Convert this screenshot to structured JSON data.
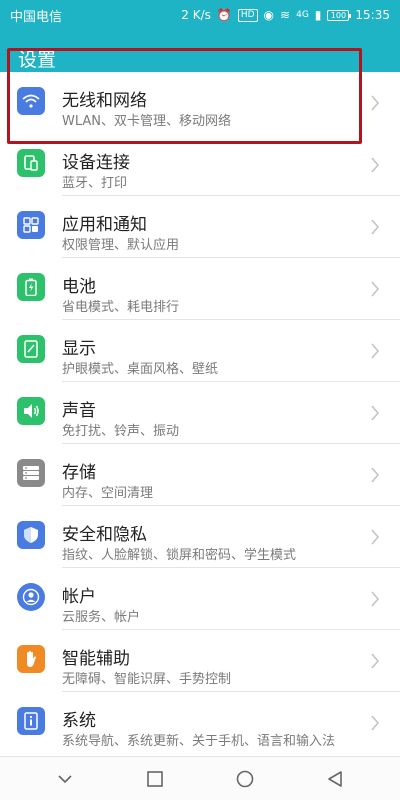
{
  "status_bar": {
    "carrier": "中国电信",
    "speed": "2 K/s",
    "hd": "HD",
    "network": "4G",
    "battery": "100",
    "time": "15:35"
  },
  "header": {
    "title": "设置"
  },
  "items": [
    {
      "title": "无线和网络",
      "subtitle": "WLAN、双卡管理、移动网络",
      "icon": "wifi-icon",
      "color": "#4a7be0"
    },
    {
      "title": "设备连接",
      "subtitle": "蓝牙、打印",
      "icon": "device-connect-icon",
      "color": "#2ec16b"
    },
    {
      "title": "应用和通知",
      "subtitle": "权限管理、默认应用",
      "icon": "apps-icon",
      "color": "#4a7be0"
    },
    {
      "title": "电池",
      "subtitle": "省电模式、耗电排行",
      "icon": "battery-icon",
      "color": "#2ec16b"
    },
    {
      "title": "显示",
      "subtitle": "护眼模式、桌面风格、壁纸",
      "icon": "display-icon",
      "color": "#2ec16b"
    },
    {
      "title": "声音",
      "subtitle": "免打扰、铃声、振动",
      "icon": "sound-icon",
      "color": "#2ec16b"
    },
    {
      "title": "存储",
      "subtitle": "内存、空间清理",
      "icon": "storage-icon",
      "color": "#8a8a8a"
    },
    {
      "title": "安全和隐私",
      "subtitle": "指纹、人脸解锁、锁屏和密码、学生模式",
      "icon": "shield-icon",
      "color": "#4a7be0"
    },
    {
      "title": "帐户",
      "subtitle": "云服务、帐户",
      "icon": "account-icon",
      "color": "#4a7be0"
    },
    {
      "title": "智能辅助",
      "subtitle": "无障碍、智能识屏、手势控制",
      "icon": "hand-icon",
      "color": "#f08a24"
    },
    {
      "title": "系统",
      "subtitle": "系统导航、系统更新、关于手机、语言和输入法",
      "icon": "system-info-icon",
      "color": "#4a7be0"
    }
  ],
  "nav": {
    "back": "back-icon",
    "home": "home-icon",
    "recents": "recents-icon",
    "collapse": "collapse-icon"
  }
}
